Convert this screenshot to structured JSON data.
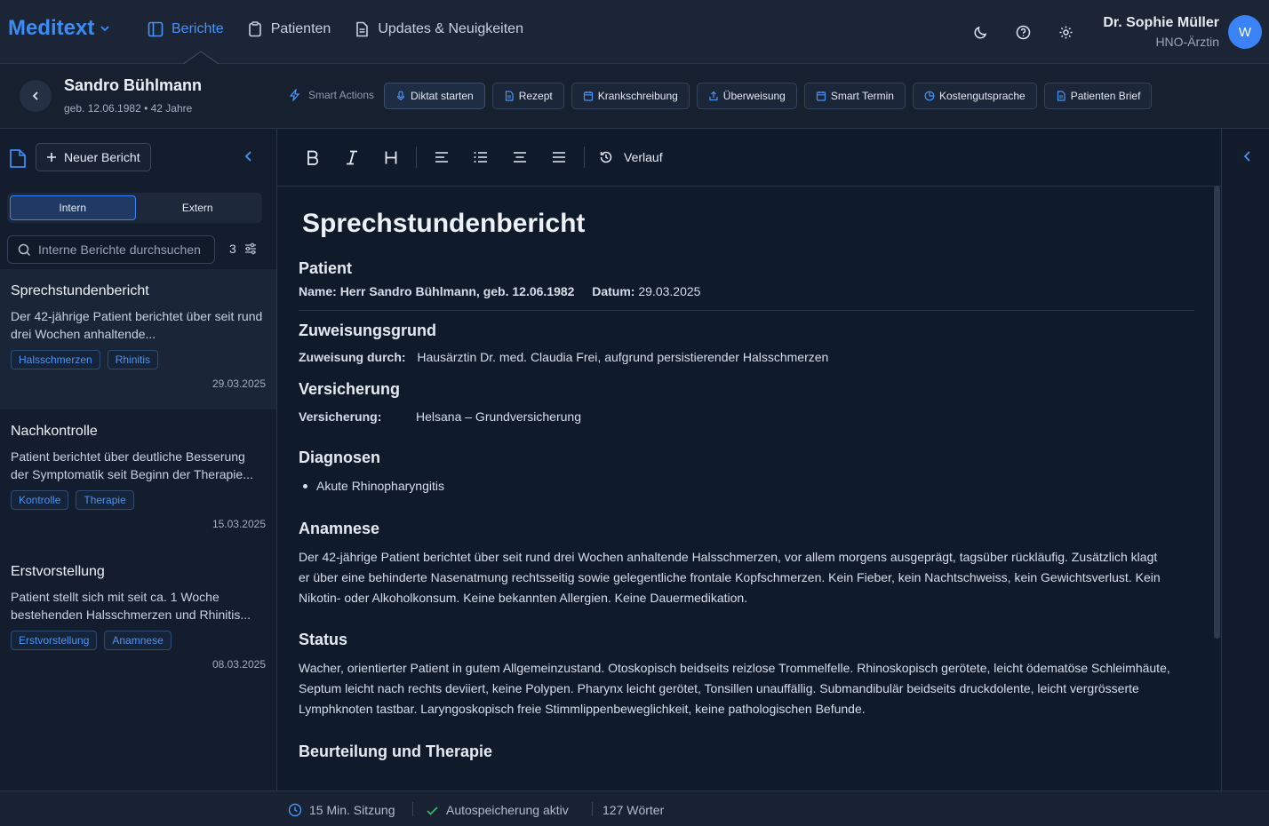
{
  "app": {
    "brand": "Meditext"
  },
  "nav": {
    "items": [
      {
        "label": "Berichte",
        "icon": "layout-icon"
      },
      {
        "label": "Patienten",
        "icon": "clipboard-icon"
      },
      {
        "label": "Updates & Neuigkeiten",
        "icon": "file-text-icon"
      }
    ],
    "active": "Berichte"
  },
  "user": {
    "name": "Dr. Sophie Müller",
    "role": "HNO-Ärztin",
    "initial": "W"
  },
  "patient": {
    "name": "Sandro Bühlmann",
    "meta": "geb. 12.06.1982 • 42 Jahre"
  },
  "smart_actions": {
    "label": "Smart Actions",
    "buttons": [
      "Diktat starten",
      "Rezept",
      "Krankschreibung",
      "Überweisung",
      "Smart Termin",
      "Kostengutsprache",
      "Patienten Brief"
    ]
  },
  "sidebar": {
    "new_report": "Neuer Bericht",
    "tabs": [
      "Intern",
      "Extern"
    ],
    "active_tab": "Intern",
    "search_placeholder": "Interne Berichte durchsuchen",
    "count": "3",
    "reports": [
      {
        "title": "Sprechstundenbericht",
        "summary": "Der 42-jährige Patient berichtet über seit rund drei Wochen anhaltende...",
        "tags": [
          "Halsschmerzen",
          "Rhinitis"
        ],
        "date": "29.03.2025"
      },
      {
        "title": "Nachkontrolle",
        "summary": "Patient berichtet über deutliche Besserung der Symptomatik seit Beginn der Therapie...",
        "tags": [
          "Kontrolle",
          "Therapie"
        ],
        "date": "15.03.2025"
      },
      {
        "title": "Erstvorstellung",
        "summary": "Patient stellt sich mit seit ca. 1 Woche bestehenden Halsschmerzen und Rhinitis...",
        "tags": [
          "Erstvorstellung",
          "Anamnese"
        ],
        "date": "08.03.2025"
      }
    ]
  },
  "toolbar": {
    "bold": "B",
    "italic": "I",
    "heading": "H",
    "history": "Verlauf"
  },
  "document": {
    "title": "Sprechstundenbericht",
    "patient_heading": "Patient",
    "name_label": "Name:",
    "name_value": "Herr Sandro Bühlmann, geb. 12.06.1982",
    "date_label": "Datum:",
    "date_value": "29.03.2025",
    "referral_heading": "Zuweisungsgrund",
    "referral_label": "Zuweisung durch:",
    "referral_value": "Hausärztin Dr. med. Claudia Frei, aufgrund persistierender Halsschmerzen",
    "insurance_heading": "Versicherung",
    "insurance_label": "Versicherung:",
    "insurance_value": "Helsana – Grundversicherung",
    "diagnoses_heading": "Diagnosen",
    "diagnoses": [
      "Akute Rhinopharyngitis"
    ],
    "anamnesis_heading": "Anamnese",
    "anamnesis_lines": [
      "Der 42-jährige Patient berichtet über seit rund drei Wochen anhaltende Halsschmerzen, vor allem morgens ausgeprägt, tagsüber rückläufig. Zusätzlich klagt",
      "er über eine behinderte Nasenatmung rechtsseitig sowie gelegentliche frontale Kopfschmerzen. Kein Fieber, kein Nachtschweiss, kein Gewichtsverlust. Kein",
      "Nikotin- oder Alkoholkonsum. Keine bekannten Allergien. Keine Dauermedikation."
    ],
    "status_heading": "Status",
    "status_lines": [
      "Wacher, orientierter Patient in gutem Allgemeinzustand. Otoskopisch beidseits reizlose Trommelfelle. Rhinoskopisch gerötete, leicht ödematöse Schleimhäute,",
      "Septum leicht nach rechts deviiert, keine Polypen. Pharynx leicht gerötet, Tonsillen unauffällig. Submandibulär beidseits druckdolente, leicht vergrösserte",
      "Lymphknoten tastbar. Laryngoskopisch freie Stimmlippenbeweglichkeit, keine pathologischen Befunde."
    ],
    "assessment_heading": "Beurteilung und Therapie"
  },
  "status": {
    "session": "15 Min. Sitzung",
    "autosave": "Autospeicherung aktiv",
    "words": "127 Wörter"
  },
  "colors": {
    "accent": "#3b8cf3",
    "background": "#0f1a2b",
    "success": "#22c55e"
  }
}
